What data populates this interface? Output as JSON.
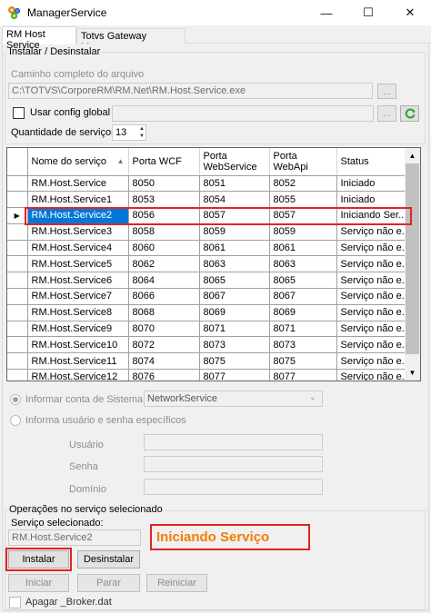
{
  "window": {
    "title": "ManagerService",
    "minimize": "—",
    "maximize": "☐",
    "close": "✕"
  },
  "tabs": [
    {
      "label": "RM Host Service"
    },
    {
      "label": "Totvs Gateway Manager"
    }
  ],
  "install_group": {
    "legend": "Instalar / Desinstalar",
    "path_label": "Caminho completo do arquivo",
    "path_value": "C:\\TOTVS\\CorporeRM\\RM.Net\\RM.Host.Service.exe",
    "browse_label": "...",
    "use_global_config_label": "Usar config global",
    "global_browse_label": "...",
    "service_count_label": "Quantidade de serviços",
    "service_count_value": "13"
  },
  "grid": {
    "columns": [
      "Nome do serviço",
      "Porta WCF",
      "Porta WebService",
      "Porta WebApi",
      "Status"
    ],
    "selected_marker": "▶",
    "rows": [
      [
        "RM.Host.Service",
        "8050",
        "8051",
        "8052",
        "Iniciado"
      ],
      [
        "RM.Host.Service1",
        "8053",
        "8054",
        "8055",
        "Iniciado"
      ],
      [
        "RM.Host.Service2",
        "8056",
        "8057",
        "8057",
        "Iniciando Ser..."
      ],
      [
        "RM.Host.Service3",
        "8058",
        "8059",
        "8059",
        "Serviço não e..."
      ],
      [
        "RM.Host.Service4",
        "8060",
        "8061",
        "8061",
        "Serviço não e..."
      ],
      [
        "RM.Host.Service5",
        "8062",
        "8063",
        "8063",
        "Serviço não e..."
      ],
      [
        "RM.Host.Service6",
        "8064",
        "8065",
        "8065",
        "Serviço não e..."
      ],
      [
        "RM.Host.Service7",
        "8066",
        "8067",
        "8067",
        "Serviço não e..."
      ],
      [
        "RM.Host.Service8",
        "8068",
        "8069",
        "8069",
        "Serviço não e..."
      ],
      [
        "RM.Host.Service9",
        "8070",
        "8071",
        "8071",
        "Serviço não e..."
      ],
      [
        "RM.Host.Service10",
        "8072",
        "8073",
        "8073",
        "Serviço não e..."
      ],
      [
        "RM.Host.Service11",
        "8074",
        "8075",
        "8075",
        "Serviço não e..."
      ],
      [
        "RM.Host.Service12",
        "8076",
        "8077",
        "8077",
        "Serviço não e..."
      ]
    ],
    "selected_row": 2
  },
  "account": {
    "system_account_label": "Informar conta de Sistema",
    "system_account_value": "NetworkService",
    "user_password_label": "Informa usuário e senha específicos",
    "user_label": "Usuário",
    "password_label": "Senha",
    "domain_label": "Domínio"
  },
  "operations": {
    "legend": "Operações no serviço selecionado",
    "selected_service_label": "Serviço selecionado:",
    "selected_service_value": "RM.Host.Service2",
    "status_text": "Iniciando Serviço",
    "install_label": "Instalar",
    "uninstall_label": "Desinstalar",
    "start_label": "Iniciar",
    "stop_label": "Parar",
    "restart_label": "Reiniciar",
    "delete_broker_label": "Apagar _Broker.dat"
  },
  "colors": {
    "selection": "#0078d7",
    "highlight_box": "#e52222",
    "status_text": "#f57c00"
  }
}
